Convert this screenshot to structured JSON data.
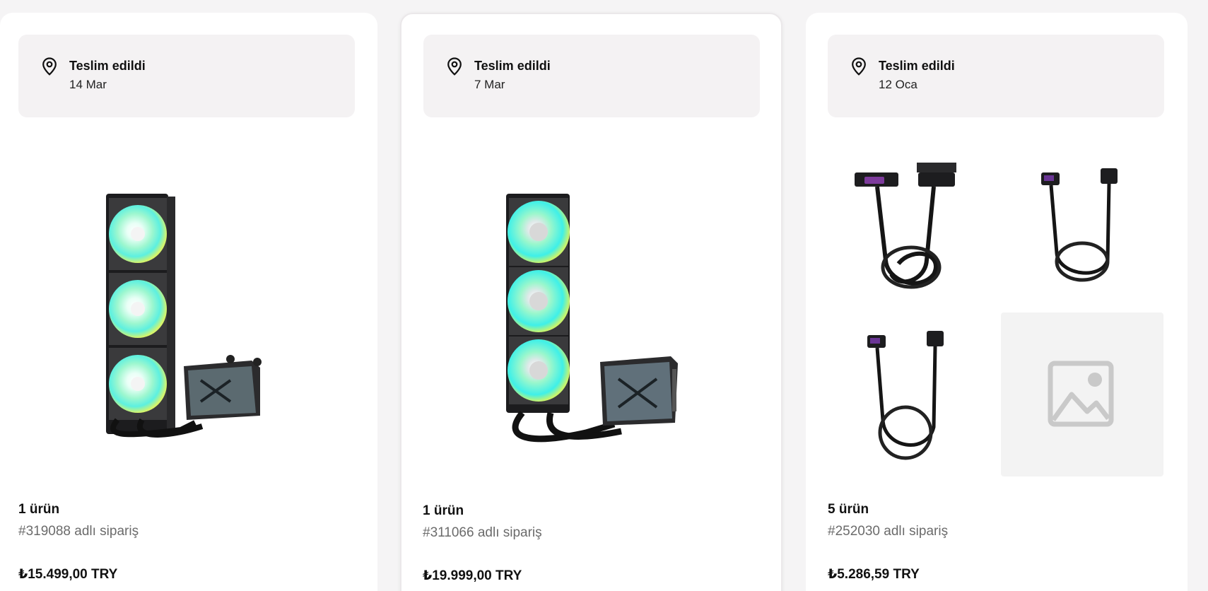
{
  "orders": [
    {
      "status": "Teslim edildi",
      "date": "14 Mar",
      "item_count": "1 ürün",
      "order_label": "#319088 adlı sipariş",
      "price": "₺15.499,00 TRY",
      "product_icon": "aio-cooler-image"
    },
    {
      "status": "Teslim edildi",
      "date": "7 Mar",
      "item_count": "1 ürün",
      "order_label": "#311066 adlı sipariş",
      "price": "₺19.999,00 TRY",
      "product_icon": "aio-cooler-image"
    },
    {
      "status": "Teslim edildi",
      "date": "12 Oca",
      "item_count": "5 ürün",
      "order_label": "#252030 adlı sipariş",
      "price": "₺5.286,59 TRY",
      "product_icons": [
        "cable-24pin-image",
        "cable-8pin-image",
        "cable-8pin-image",
        "image-placeholder-icon"
      ]
    }
  ],
  "colors": {
    "page_bg": "#f5f4f5",
    "card_bg": "#ffffff",
    "status_bg": "#f4f2f3",
    "muted_text": "#6b6b6b",
    "fan_glow": "#56f2d8"
  }
}
